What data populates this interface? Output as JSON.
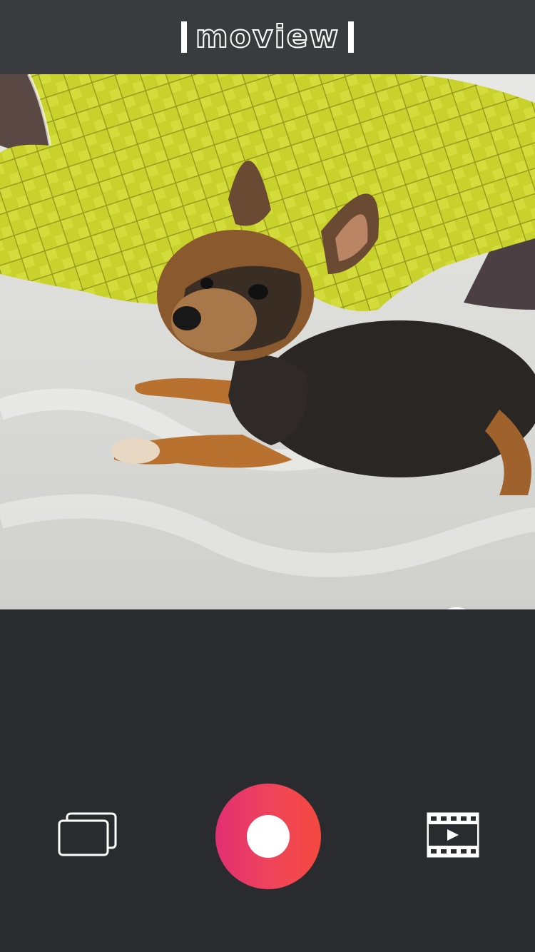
{
  "header": {
    "logo_text": "moview"
  },
  "camera": {
    "preview_subject": "dog-photo",
    "flip_icon": "camera-flip-icon"
  },
  "controls": {
    "gallery_icon": "gallery-icon",
    "record_icon": "record-icon",
    "video_list_icon": "film-icon"
  },
  "colors": {
    "header_bg": "#3a3b3e",
    "body_bg": "#2a2b2e",
    "record_gradient_start": "#e12f72",
    "record_gradient_end": "#f4493f"
  }
}
